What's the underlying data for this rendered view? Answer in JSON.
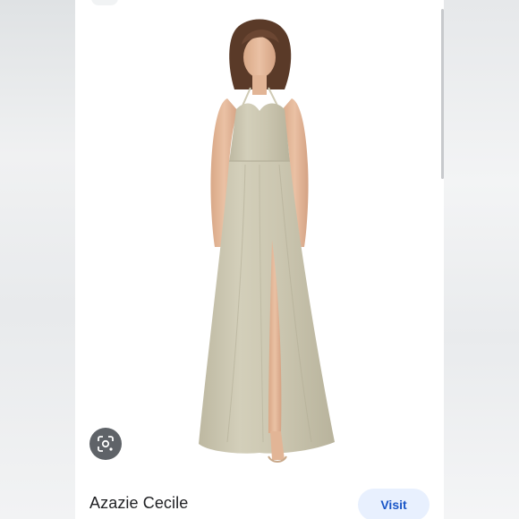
{
  "result": {
    "title": "Azazie Cecile",
    "visit_label": "Visit",
    "image": {
      "subject": "model wearing sage halter chiffon gown with front slit",
      "dress_color": "#cfcab4",
      "background_color": "#ffffff"
    }
  },
  "controls": {
    "lens_icon": "google-lens-icon"
  },
  "colors": {
    "accent": "#1a56c7",
    "visit_bg": "#e8f0fe",
    "lens_bg": "#5f6368"
  }
}
